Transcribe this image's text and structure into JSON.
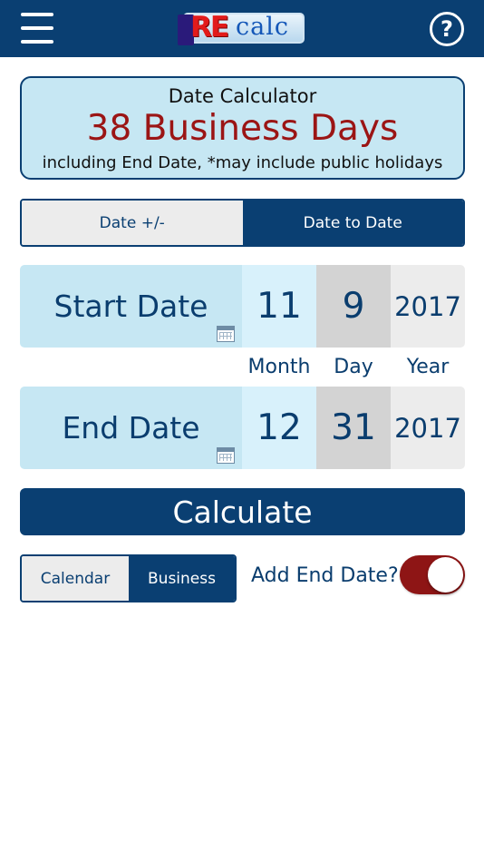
{
  "header": {
    "logo_prefix": "RE",
    "logo_suffix": "calc",
    "help_symbol": "?",
    "menu_icon": "hamburger-menu-icon",
    "help_icon": "question-circle-icon"
  },
  "result": {
    "title": "Date Calculator",
    "value": "38 Business Days",
    "note": "including End Date, *may include public holidays"
  },
  "mode_tabs": [
    {
      "label": "Date +/-",
      "selected": false
    },
    {
      "label": "Date to Date",
      "selected": true
    }
  ],
  "start_date": {
    "label": "Start Date",
    "month": "11",
    "day": "9",
    "year": "2017"
  },
  "end_date": {
    "label": "End Date",
    "month": "12",
    "day": "31",
    "year": "2017"
  },
  "column_labels": {
    "month": "Month",
    "day": "Day",
    "year": "Year"
  },
  "calculate_label": "Calculate",
  "day_type_tabs": [
    {
      "label": "Calendar",
      "selected": false
    },
    {
      "label": "Business",
      "selected": true
    }
  ],
  "add_end_date": {
    "label": "Add End Date?",
    "enabled": true
  },
  "colors": {
    "primary": "#0a3f72",
    "result_bg": "#c6e7f3",
    "result_value": "#9b1515",
    "toggle_on": "#8e1515"
  }
}
